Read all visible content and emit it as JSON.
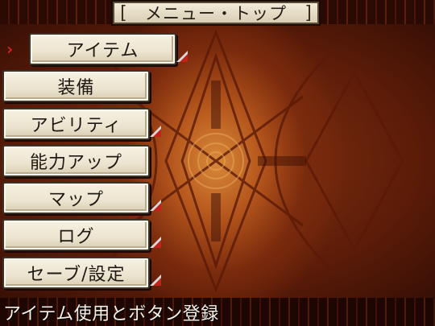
{
  "screen": {
    "title": "メニュー・トップ",
    "title_bracket_left": "[",
    "title_bracket_right": "]"
  },
  "menu": {
    "cursor_glyph": "›",
    "items": [
      {
        "label": "アイテム",
        "selected": true,
        "has_submenu": true
      },
      {
        "label": "装備",
        "selected": false,
        "has_submenu": false
      },
      {
        "label": "アビリティ",
        "selected": false,
        "has_submenu": true
      },
      {
        "label": "能力アップ",
        "selected": false,
        "has_submenu": false
      },
      {
        "label": "マップ",
        "selected": false,
        "has_submenu": true
      },
      {
        "label": "ログ",
        "selected": false,
        "has_submenu": true
      },
      {
        "label": "セーブ/設定",
        "selected": false,
        "has_submenu": true
      }
    ]
  },
  "help": {
    "text": "アイテム使用とボタン登録"
  },
  "colors": {
    "background_dark": "#2a0c05",
    "background_glow": "#d98a3a",
    "button_face": "#f6f1e2",
    "cursor": "#e0241a",
    "submenu_marker": "#c2221a",
    "help_text": "#f4f0e6"
  }
}
